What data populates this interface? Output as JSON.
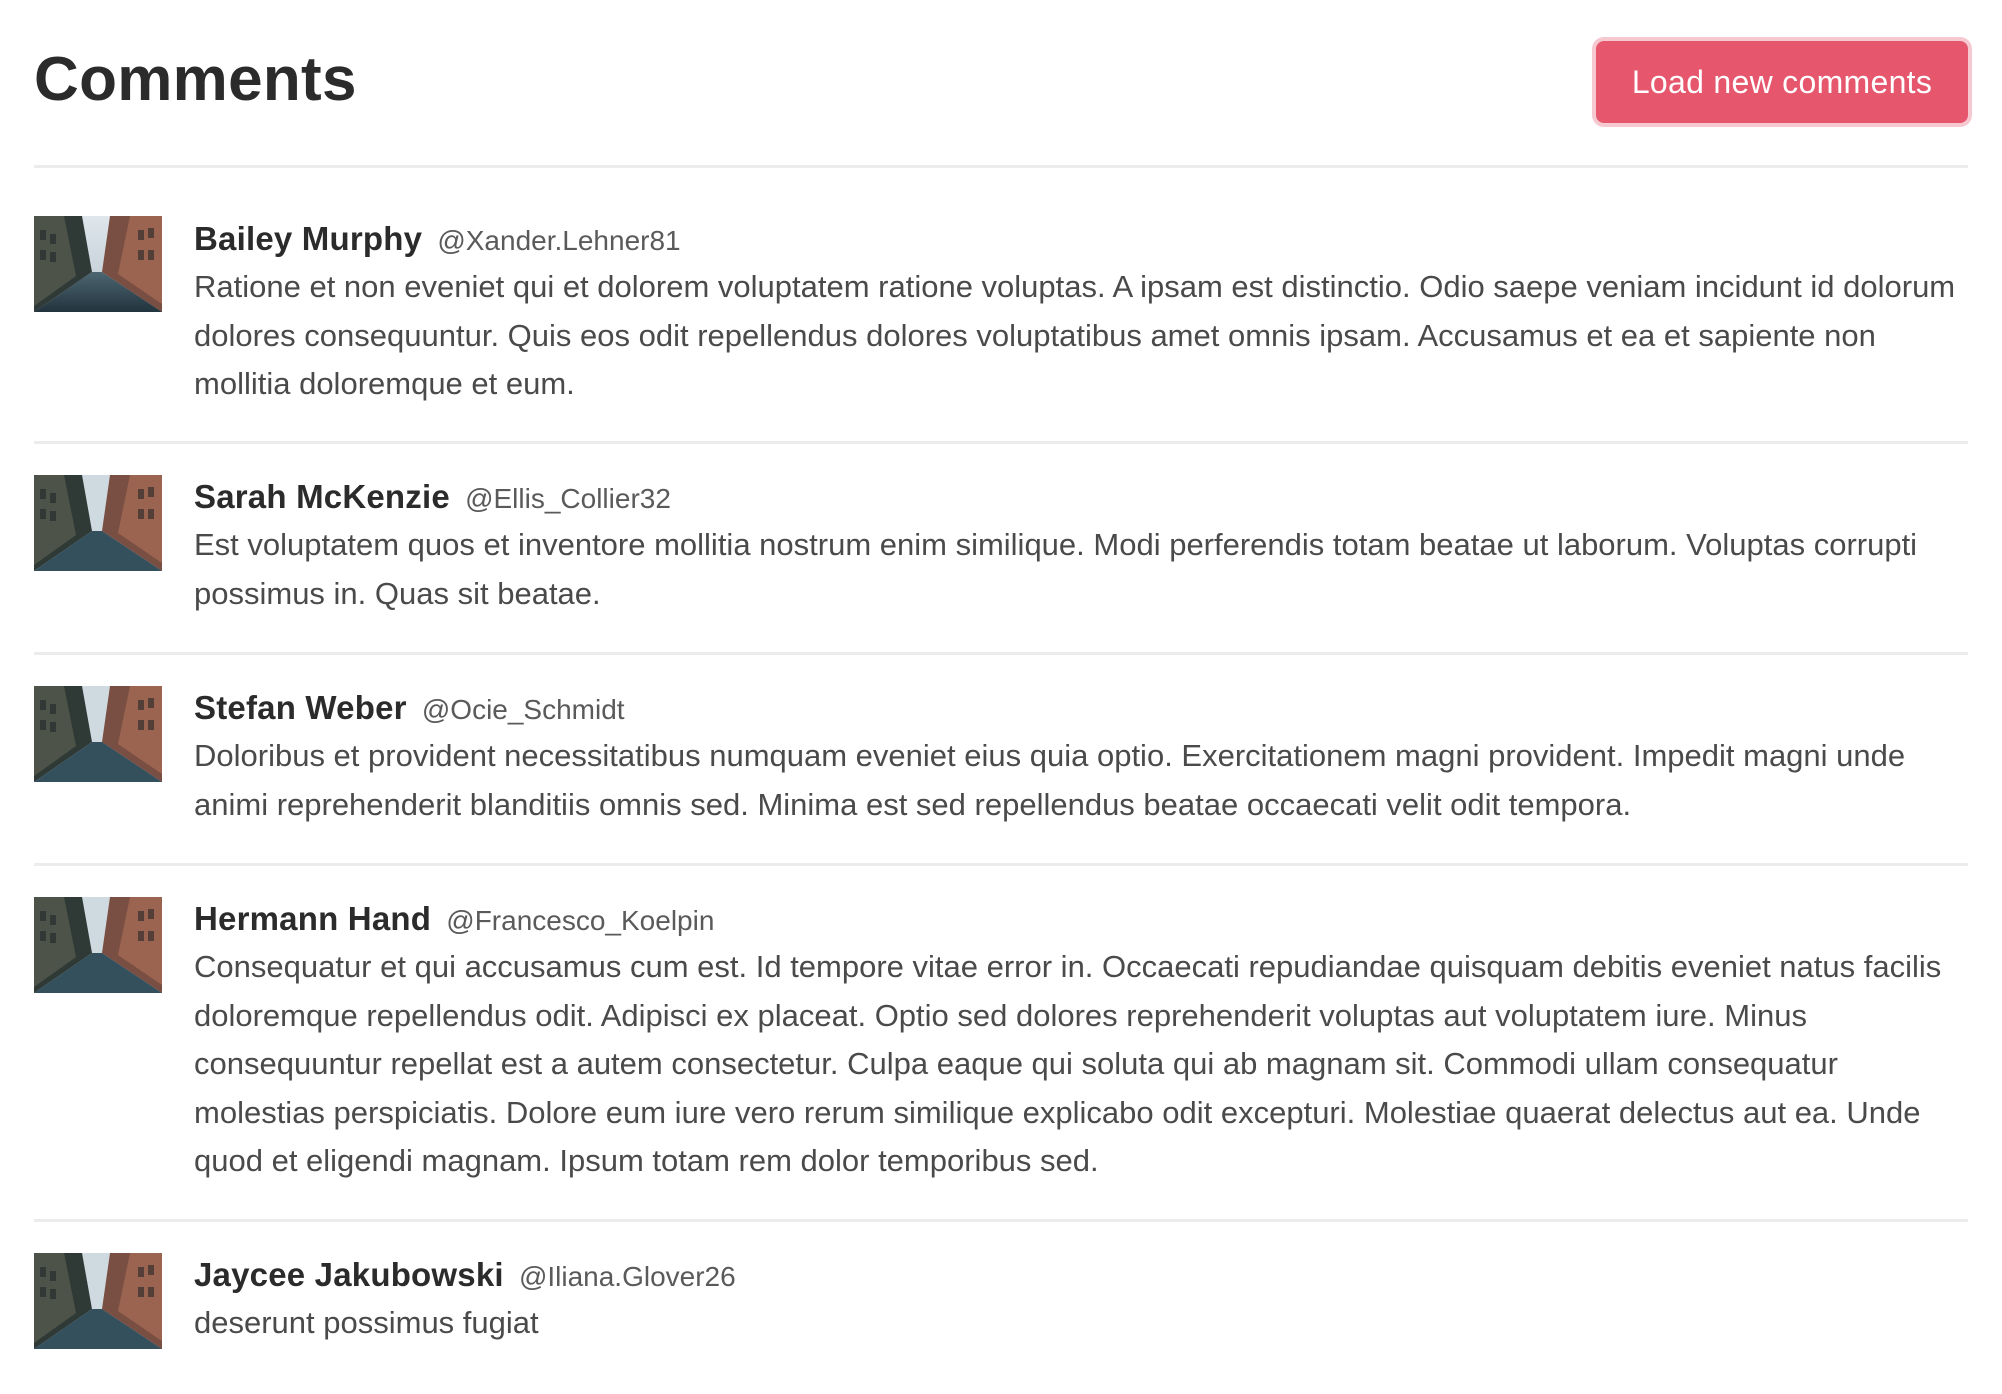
{
  "header": {
    "title": "Comments",
    "load_button_label": "Load new comments"
  },
  "colors": {
    "accent": "#e6566c",
    "text": "#4a4a4a",
    "heading": "#2b2b2b",
    "divider": "#ececec"
  },
  "comments": [
    {
      "author": "Bailey Murphy",
      "handle": "@Xander.Lehner81",
      "avatar": "city-street-photo",
      "text": "Ratione et non eveniet qui et dolorem voluptatem ratione voluptas. A ipsam est distinctio. Odio saepe veniam incidunt id dolorum dolores consequuntur. Quis eos odit repellendus dolores voluptatibus amet omnis ipsam. Accusamus et ea et sapiente non mollitia doloremque et eum."
    },
    {
      "author": "Sarah McKenzie",
      "handle": "@Ellis_Collier32",
      "avatar": "city-street-photo",
      "text": "Est voluptatem quos et inventore mollitia nostrum enim similique. Modi perferendis totam beatae ut laborum. Voluptas corrupti possimus in. Quas sit beatae."
    },
    {
      "author": "Stefan Weber",
      "handle": "@Ocie_Schmidt",
      "avatar": "city-street-photo",
      "text": "Doloribus et provident necessitatibus numquam eveniet eius quia optio. Exercitationem magni provident. Impedit magni unde animi reprehenderit blanditiis omnis sed. Minima est sed repellendus beatae occaecati velit odit tempora."
    },
    {
      "author": "Hermann Hand",
      "handle": "@Francesco_Koelpin",
      "avatar": "city-street-photo",
      "text": "Consequatur et qui accusamus cum est. Id tempore vitae error in. Occaecati repudiandae quisquam debitis eveniet natus facilis doloremque repellendus odit. Adipisci ex placeat. Optio sed dolores reprehenderit voluptas aut voluptatem iure. Minus consequuntur repellat est a autem consectetur. Culpa eaque qui soluta qui ab magnam sit. Commodi ullam consequatur molestias perspiciatis. Dolore eum iure vero rerum similique explicabo odit excepturi. Molestiae quaerat delectus aut ea. Unde quod et eligendi magnam. Ipsum totam rem dolor temporibus sed."
    },
    {
      "author": "Jaycee Jakubowski",
      "handle": "@Iliana.Glover26",
      "avatar": "city-street-photo",
      "text": "deserunt possimus fugiat"
    }
  ]
}
